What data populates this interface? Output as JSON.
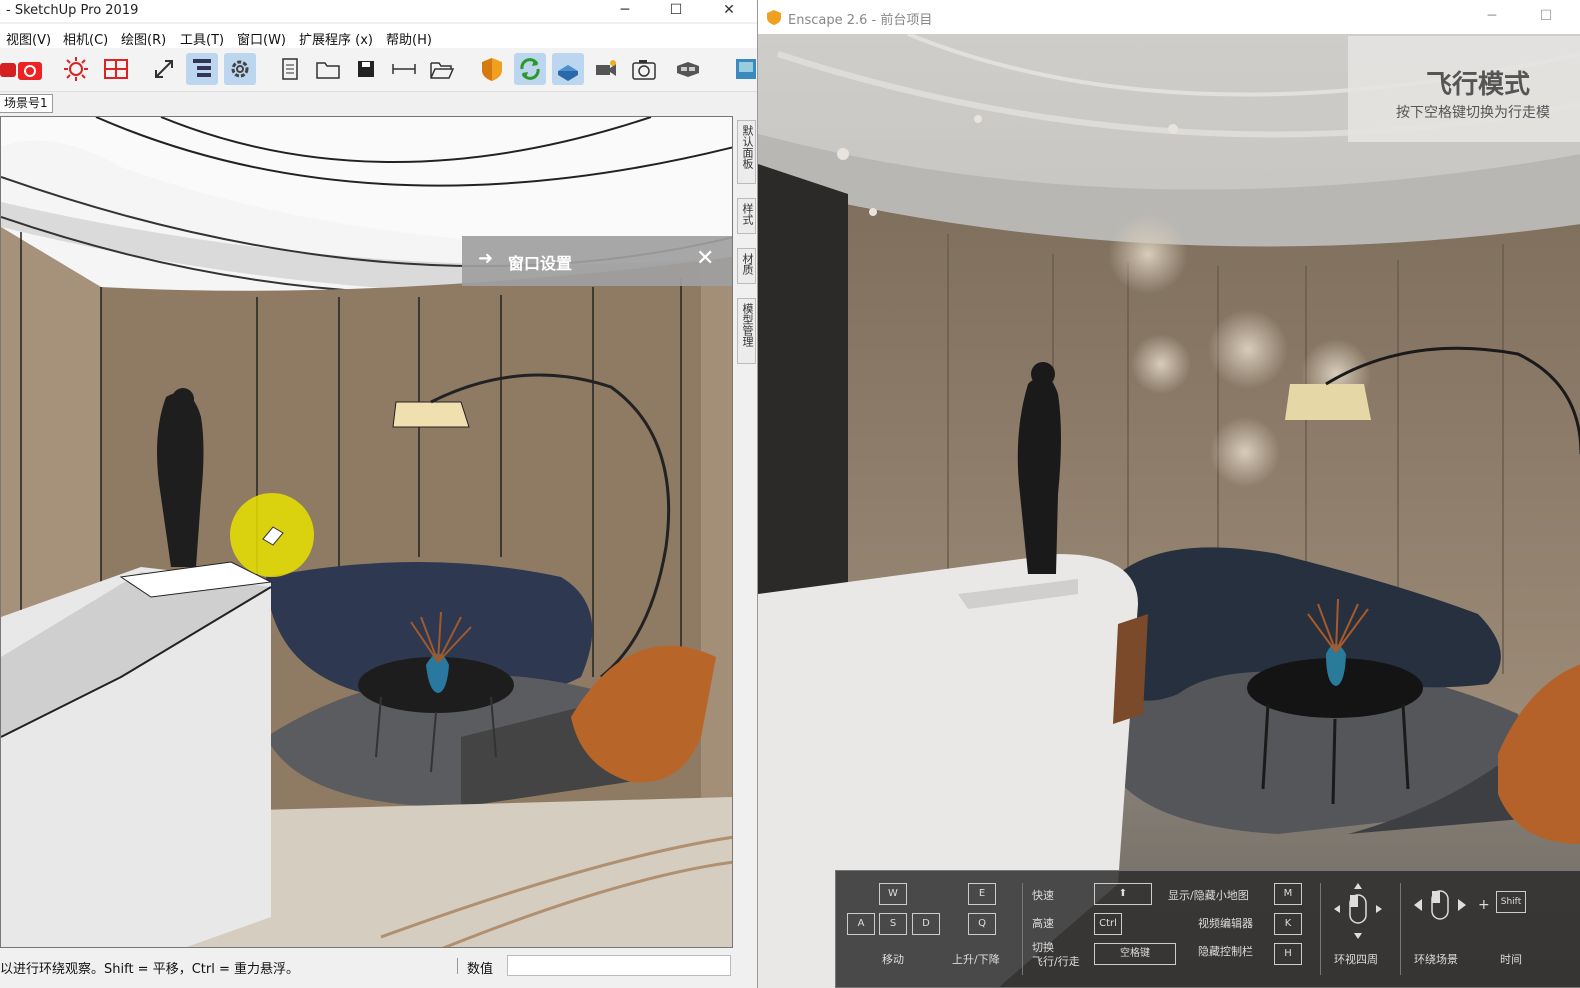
{
  "sketchup": {
    "title": "- SketchUp Pro 2019",
    "window_controls": {
      "minimize": "─",
      "maximize": "☐",
      "close": "✕"
    },
    "menu": [
      "视图(V)",
      "相机(C)",
      "绘图(R)",
      "工具(T)",
      "窗口(W)",
      "扩展程序 (x)",
      "帮助(H)"
    ],
    "scene_tab": "场景号1",
    "panel_title": "窗口设置",
    "side_tabs": [
      "默认面板",
      "样式",
      "材质",
      "模型管理"
    ],
    "status_text": "以进行环绕观察。Shift = 平移，Ctrl = 重力悬浮。",
    "value_label": "数值"
  },
  "enscape": {
    "title": "Enscape 2.6 - 前台项目",
    "window_controls": {
      "minimize": "─",
      "maximize": "☐"
    },
    "mode_title": "飞行模式",
    "mode_hint": "按下空格键切换为行走模",
    "controls": {
      "keys_move": [
        "W",
        "A",
        "S",
        "D"
      ],
      "move_label": "移动",
      "keys_updown": [
        "E",
        "Q"
      ],
      "updown_label": "上升/下降",
      "fast": "快速",
      "fast_key": "⬆",
      "high": "高速",
      "high_key": "Ctrl",
      "switch": "切换",
      "switch2": "飞行/行走",
      "space_key": "空格键",
      "minimap": "显示/隐藏小地图",
      "minimap_key": "M",
      "video": "视频编辑器",
      "video_key": "K",
      "hidebar": "隐藏控制栏",
      "hidebar_key": "H",
      "look": "环视四周",
      "orbit": "环绕场景",
      "shift_key": "Shift",
      "plus": "+",
      "time": "时间"
    }
  }
}
